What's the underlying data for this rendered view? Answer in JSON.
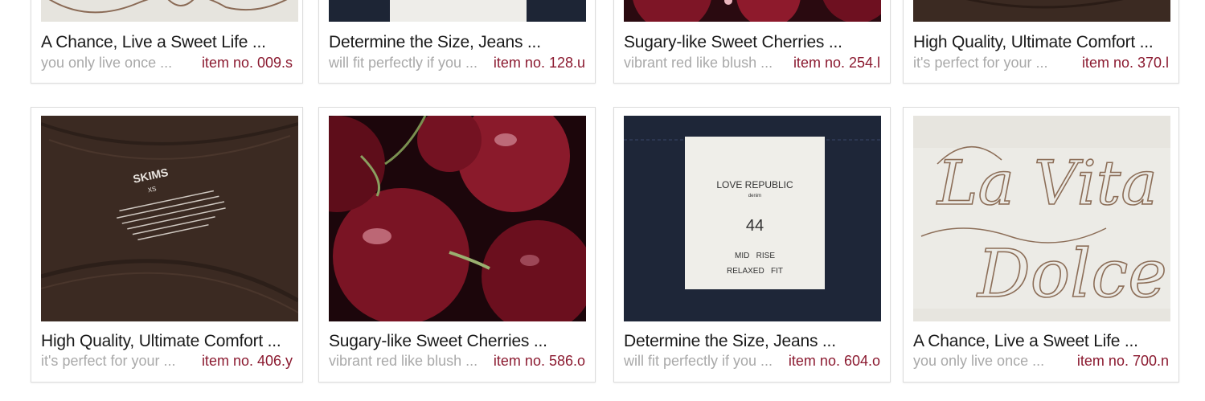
{
  "products": [
    {
      "title": "A Chance, Live a Sweet Life ...",
      "desc": "you only live once ...",
      "item_no": "item no. 009.s",
      "image": "la-vita-dolce"
    },
    {
      "title": "Determine the Size, Jeans ...",
      "desc": "will fit perfectly if you ...",
      "item_no": "item no. 128.u",
      "image": "jeans-tag"
    },
    {
      "title": "Sugary-like Sweet Cherries ...",
      "desc": "vibrant red like blush ...",
      "item_no": "item no. 254.l",
      "image": "cherries"
    },
    {
      "title": "High Quality, Ultimate Comfort ...",
      "desc": "it's perfect for your ...",
      "item_no": "item no. 370.l",
      "image": "skims-label"
    },
    {
      "title": "High Quality, Ultimate Comfort ...",
      "desc": "it's perfect for your ...",
      "item_no": "item no. 406.y",
      "image": "skims-label"
    },
    {
      "title": "Sugary-like Sweet Cherries ...",
      "desc": "vibrant red like blush ...",
      "item_no": "item no. 586.o",
      "image": "cherries"
    },
    {
      "title": "Determine the Size, Jeans ...",
      "desc": "will fit perfectly if you ...",
      "item_no": "item no. 604.o",
      "image": "jeans-tag"
    },
    {
      "title": "A Chance, Live a Sweet Life ...",
      "desc": "you only live once ...",
      "item_no": "item no. 700.n",
      "image": "la-vita-dolce"
    }
  ],
  "image_text": {
    "skims": {
      "brand": "SKIMS",
      "size": "XS"
    },
    "jeans": {
      "brand": "LOVE REPUBLIC",
      "sub": "denim",
      "size": "44",
      "line1": "MID   RISE",
      "line2": "RELAXED   FIT"
    },
    "dolce": {
      "line1": "La Vita",
      "line2": "Dolce"
    }
  },
  "colors": {
    "accent": "#8b1a30",
    "muted": "#a9a9a9",
    "title": "#1a1a1a"
  }
}
